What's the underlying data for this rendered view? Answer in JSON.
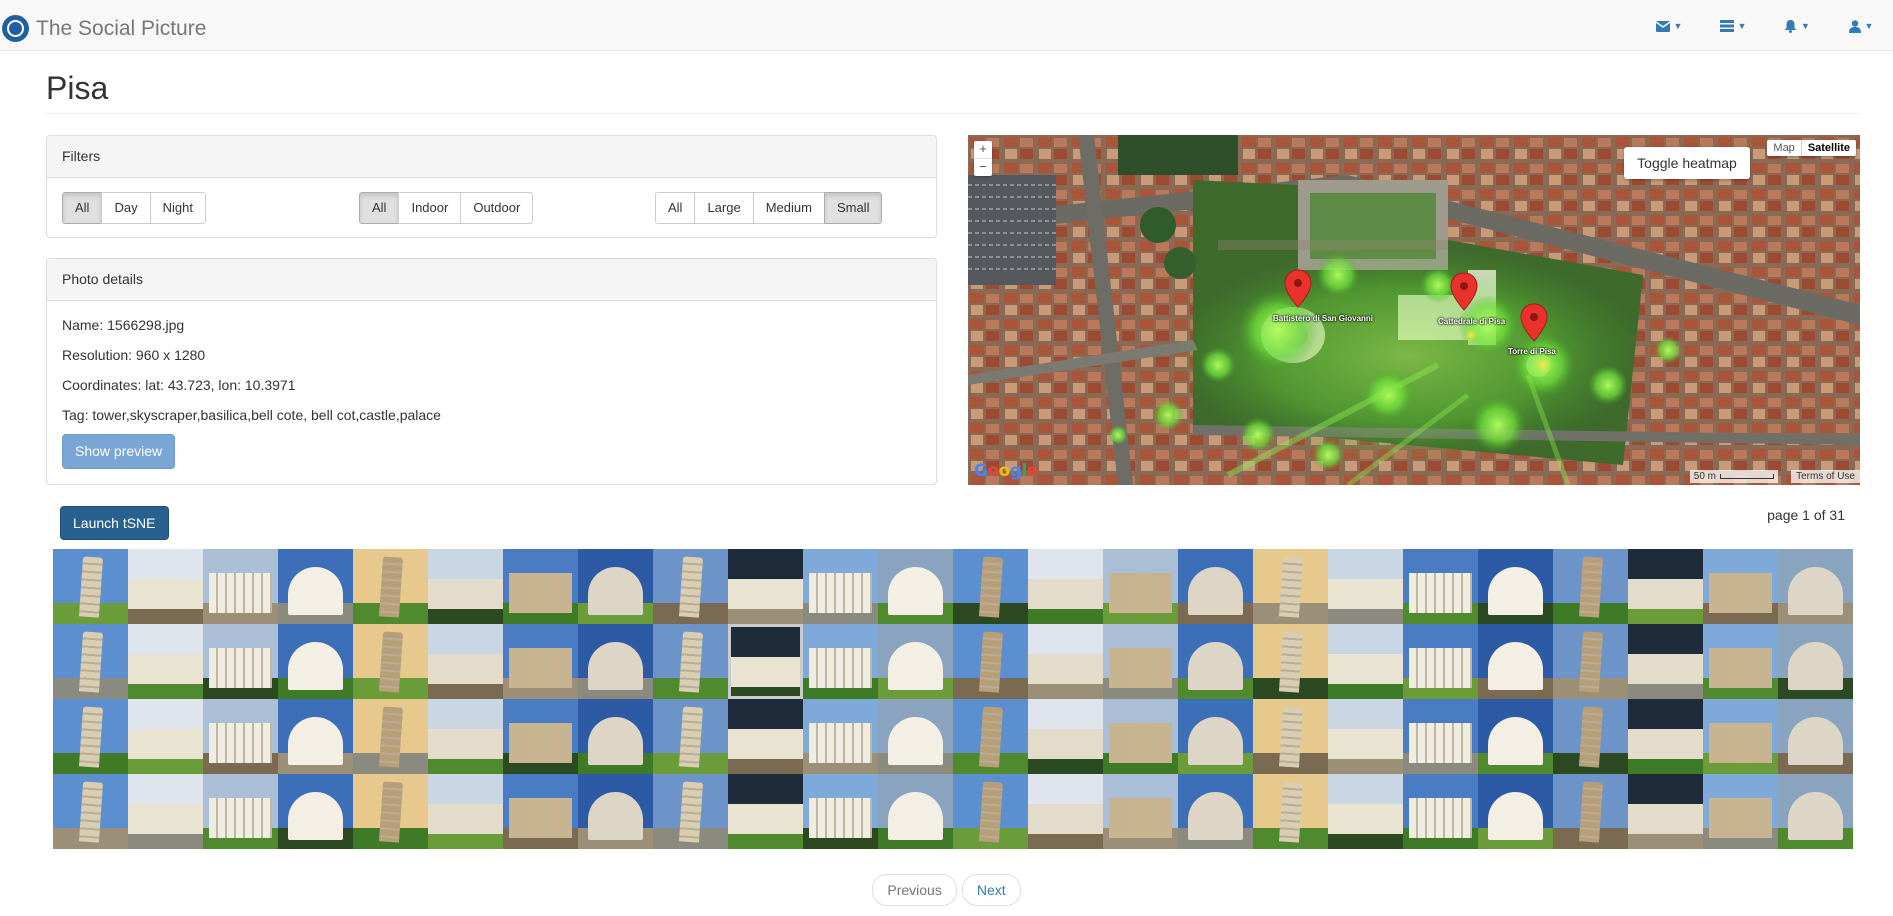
{
  "navbar": {
    "brand": "The Social Picture",
    "icons": [
      "envelope-icon",
      "server-icon",
      "bell-icon",
      "user-icon"
    ]
  },
  "page": {
    "title": "Pisa"
  },
  "filters": {
    "heading": "Filters",
    "time": {
      "options": [
        "All",
        "Day",
        "Night"
      ],
      "active": "All"
    },
    "location": {
      "options": [
        "All",
        "Indoor",
        "Outdoor"
      ],
      "active": "All"
    },
    "size": {
      "options": [
        "All",
        "Large",
        "Medium",
        "Small"
      ],
      "active": "Small"
    }
  },
  "details": {
    "heading": "Photo details",
    "name": "Name: 1566298.jpg",
    "resolution": "Resolution: 960 x 1280",
    "coordinates": "Coordinates: lat: 43.723, lon: 10.3971",
    "tags": "Tag: tower,skyscraper,basilica,bell cote, bell cot,castle,palace",
    "preview_button": "Show preview"
  },
  "map": {
    "zoom_in": "+",
    "zoom_out": "−",
    "toggle_heatmap": "Toggle heatmap",
    "type_map": "Map",
    "type_satellite": "Satellite",
    "active_type": "Satellite",
    "markers": [
      "Battistero di San Giovanni",
      "Cattedrale di Pisa",
      "Torre di Pisa"
    ],
    "scale": "50 m",
    "terms": "Terms of Use",
    "logo": "Google"
  },
  "gallery": {
    "launch_button": "Launch tSNE",
    "page_indicator": "page 1 of 31",
    "selected_index": 33,
    "thumbnail_count": 96
  },
  "pagination": {
    "previous": "Previous",
    "next": "Next"
  },
  "colors": {
    "primary": "#337ab7",
    "dark_primary": "#286090",
    "heatmap": "#6fe03a",
    "marker": "#e8322b"
  }
}
